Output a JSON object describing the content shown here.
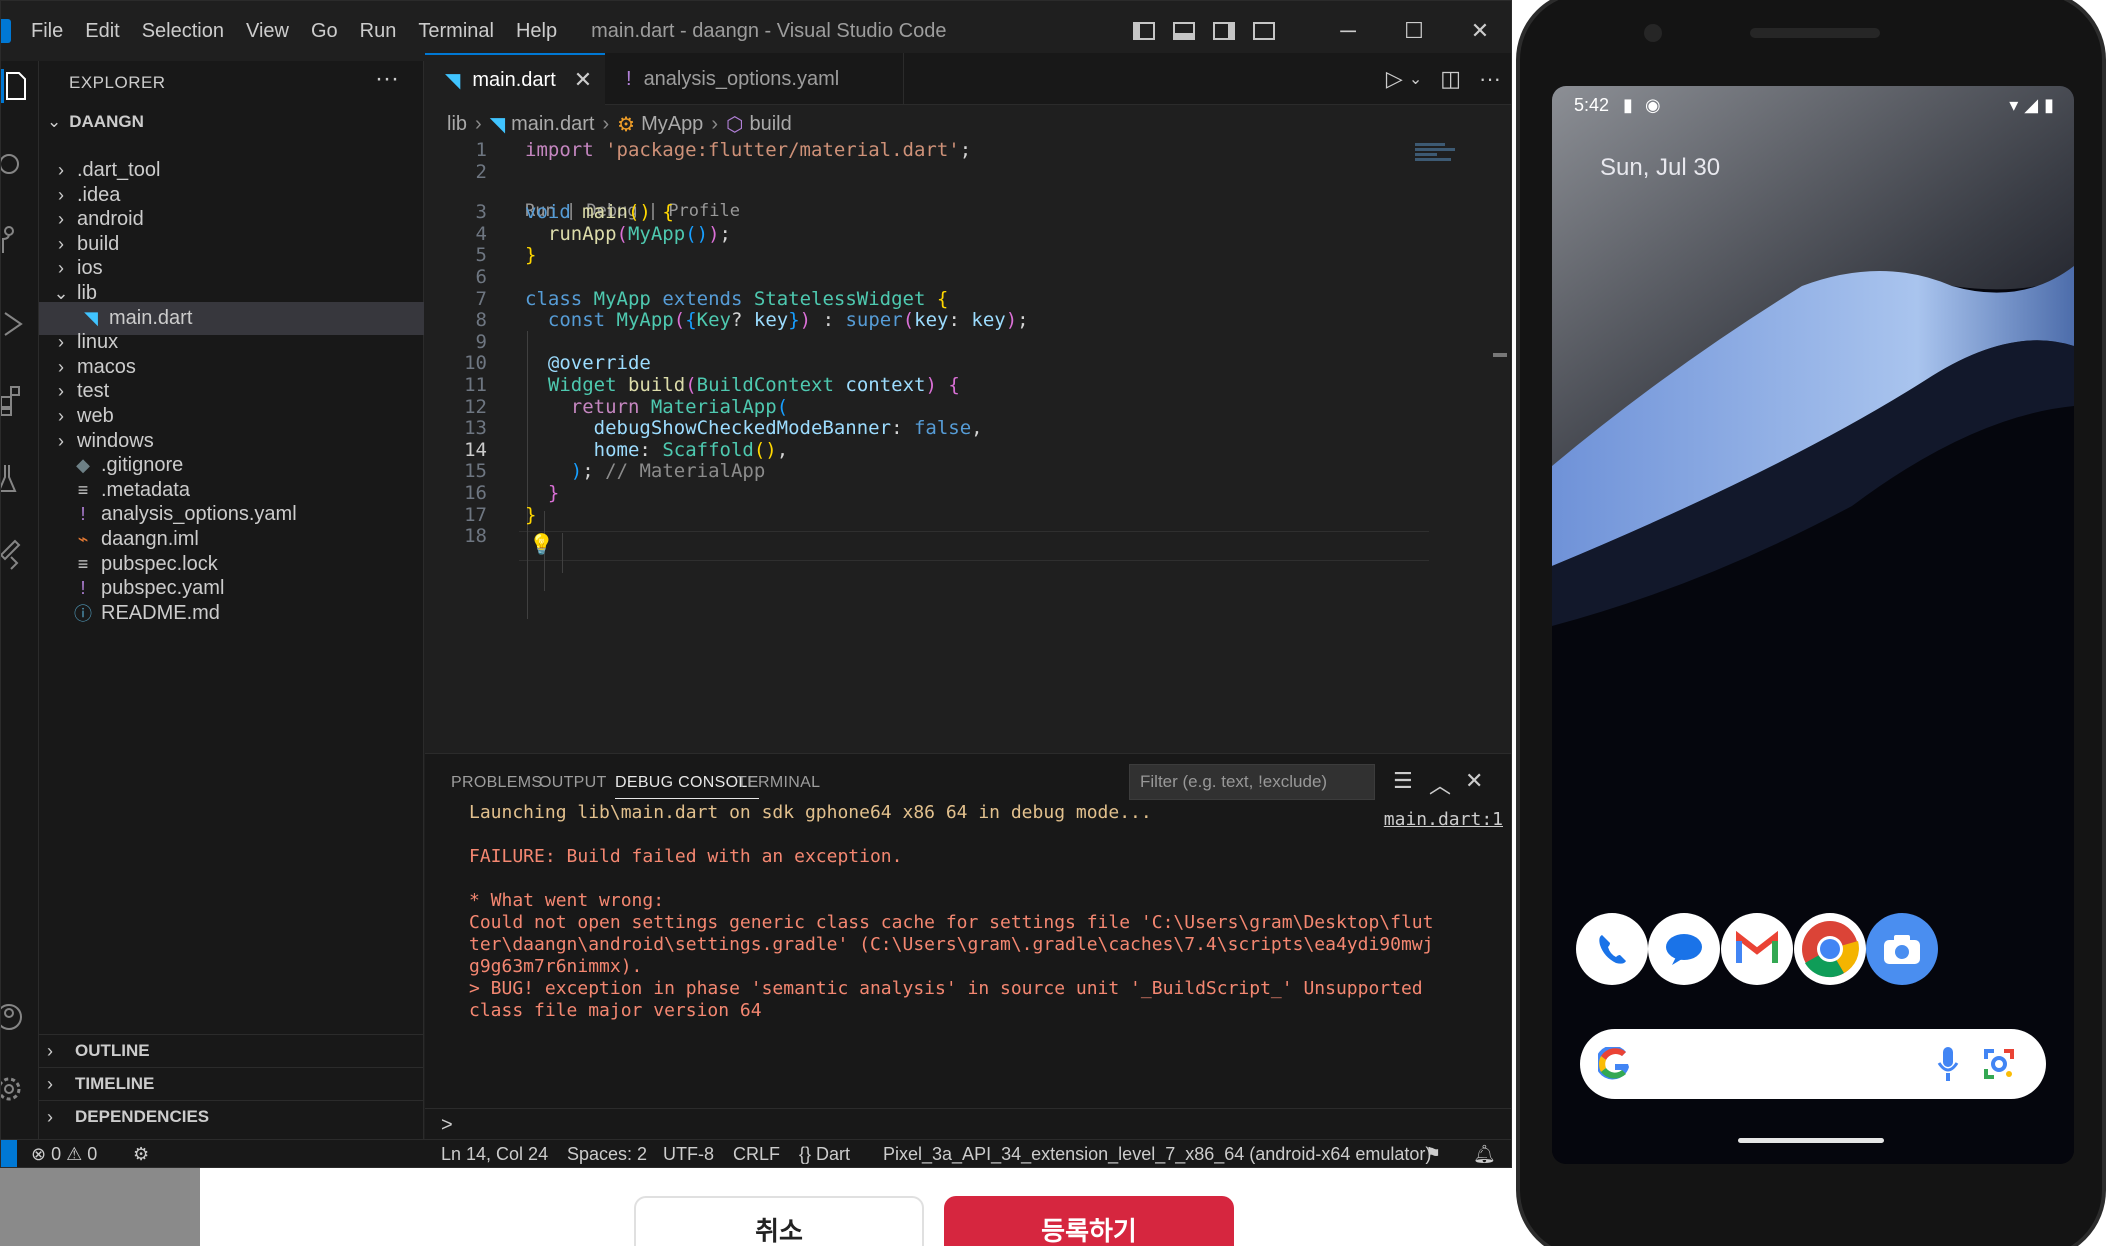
{
  "vscode": {
    "menu": [
      "File",
      "Edit",
      "Selection",
      "View",
      "Go",
      "Run",
      "Terminal",
      "Help"
    ],
    "window_title": "main.dart - daangn - Visual Studio Code",
    "controls": {
      "minimize": "─",
      "maximize": "☐",
      "close": "✕"
    }
  },
  "explorer": {
    "title": "EXPLORER",
    "more": "···",
    "project": "DAANGN",
    "tree": [
      {
        "label": ".dart_tool",
        "chev": "›",
        "icon": ""
      },
      {
        "label": ".idea",
        "chev": "›",
        "icon": ""
      },
      {
        "label": "android",
        "chev": "›",
        "icon": ""
      },
      {
        "label": "build",
        "chev": "›",
        "icon": ""
      },
      {
        "label": "ios",
        "chev": "›",
        "icon": ""
      },
      {
        "label": "lib",
        "chev": "⌄",
        "icon": ""
      },
      {
        "label": "main.dart",
        "chev": "",
        "icon": "◥"
      },
      {
        "label": "linux",
        "chev": "›",
        "icon": ""
      },
      {
        "label": "macos",
        "chev": "›",
        "icon": ""
      },
      {
        "label": "test",
        "chev": "›",
        "icon": ""
      },
      {
        "label": "web",
        "chev": "›",
        "icon": ""
      },
      {
        "label": "windows",
        "chev": "›",
        "icon": ""
      },
      {
        "label": ".gitignore",
        "chev": "",
        "icon": "◆"
      },
      {
        "label": ".metadata",
        "chev": "",
        "icon": "≡"
      },
      {
        "label": "analysis_options.yaml",
        "chev": "",
        "icon": "!"
      },
      {
        "label": "daangn.iml",
        "chev": "",
        "icon": "⌁"
      },
      {
        "label": "pubspec.lock",
        "chev": "",
        "icon": "≡"
      },
      {
        "label": "pubspec.yaml",
        "chev": "",
        "icon": "!"
      },
      {
        "label": "README.md",
        "chev": "",
        "icon": "ⓘ"
      }
    ],
    "sections": [
      "OUTLINE",
      "TIMELINE",
      "DEPENDENCIES"
    ]
  },
  "tabs": [
    {
      "label": "main.dart",
      "icon": "◥",
      "close": "✕"
    },
    {
      "label": "analysis_options.yaml",
      "icon": "!"
    }
  ],
  "tab_actions": {
    "run": "▷",
    "split": "◫",
    "more": "···"
  },
  "breadcrumb": [
    "lib",
    "main.dart",
    "MyApp",
    "build"
  ],
  "codelens": "Run | Debug | Profile",
  "line_numbers": [
    "1",
    "2",
    "3",
    "4",
    "5",
    "6",
    "7",
    "8",
    "9",
    "10",
    "11",
    "12",
    "13",
    "14",
    "15",
    "16",
    "17",
    "18"
  ],
  "panel": {
    "tabs": [
      "PROBLEMS",
      "OUTPUT",
      "DEBUG CONSOLE",
      "TERMINAL"
    ],
    "filter_placeholder": "Filter (e.g. text, !exclude)",
    "link": "main.dart:1",
    "console": [
      "Launching lib\\main.dart on sdk gphone64 x86 64 in debug mode...",
      "",
      "FAILURE: Build failed with an exception.",
      "",
      "* What went wrong:",
      "Could not open settings generic class cache for settings file 'C:\\Users\\gram\\Desktop\\flut",
      "ter\\daangn\\android\\settings.gradle' (C:\\Users\\gram\\.gradle\\caches\\7.4\\scripts\\ea4ydi90mwj",
      "g9g63m7r6nimmx).",
      "> BUG! exception in phase 'semantic analysis' in source unit '_BuildScript_' Unsupported",
      "class file major version 64"
    ],
    "prompt": ">"
  },
  "status": {
    "errors": "0",
    "warnings": "0",
    "position": "Ln 14, Col 24",
    "spaces": "Spaces: 2",
    "encoding": "UTF-8",
    "eol": "CRLF",
    "language": "Dart",
    "device": "Pixel_3a_API_34_extension_level_7_x86_64 (android-x64 emulator)"
  },
  "phone": {
    "time": "5:42",
    "date": "Sun, Jul 30",
    "dock": [
      "phone-app",
      "messages-app",
      "gmail-app",
      "chrome-app",
      "camera-app"
    ]
  },
  "background": {
    "cancel": "취소",
    "submit": "등록하기"
  },
  "colors": {
    "accent": "#0078d4",
    "error": "#f48771",
    "submit": "#d6263f"
  }
}
